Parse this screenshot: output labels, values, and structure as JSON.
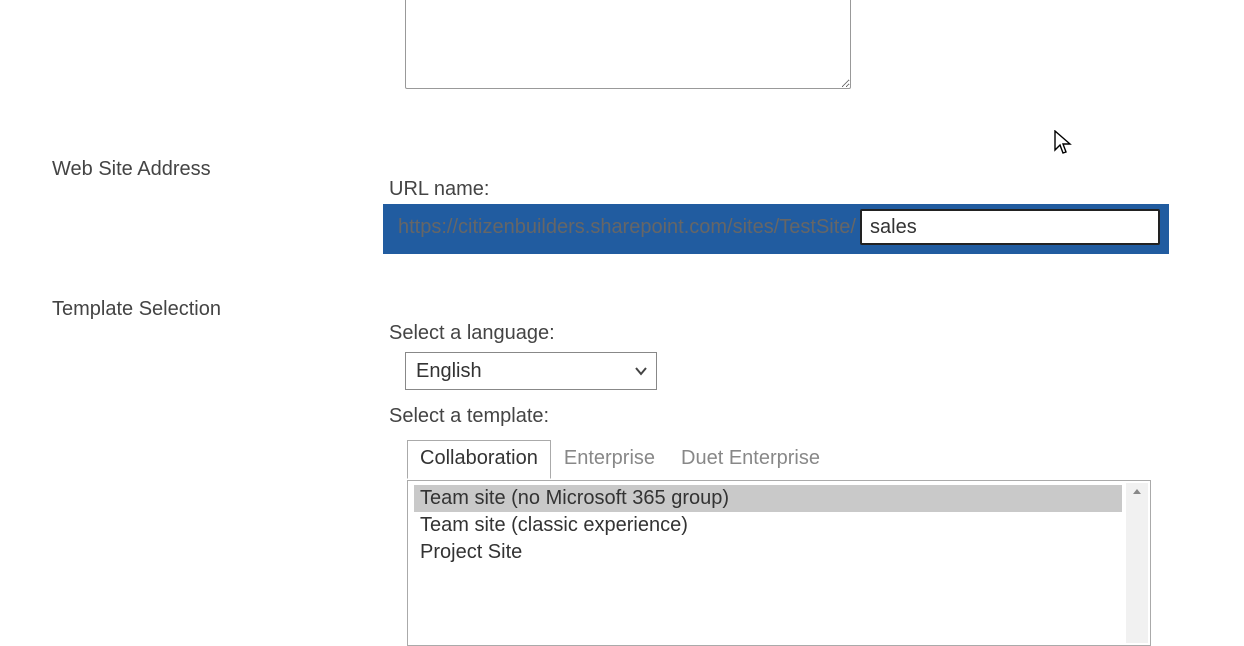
{
  "sections": {
    "web_site_address": "Web Site Address",
    "template_selection": "Template Selection"
  },
  "url": {
    "label": "URL name:",
    "prefix": "https://citizenbuilders.sharepoint.com/sites/TestSite/",
    "value": "sales"
  },
  "language": {
    "label": "Select a language:",
    "selected": "English"
  },
  "template": {
    "label": "Select a template:",
    "tabs": [
      {
        "label": "Collaboration",
        "active": true
      },
      {
        "label": "Enterprise",
        "active": false
      },
      {
        "label": "Duet Enterprise",
        "active": false
      }
    ],
    "items": [
      {
        "label": "Team site (no Microsoft 365 group)",
        "selected": true
      },
      {
        "label": "Team site (classic experience)",
        "selected": false
      },
      {
        "label": "Project Site",
        "selected": false
      }
    ]
  }
}
